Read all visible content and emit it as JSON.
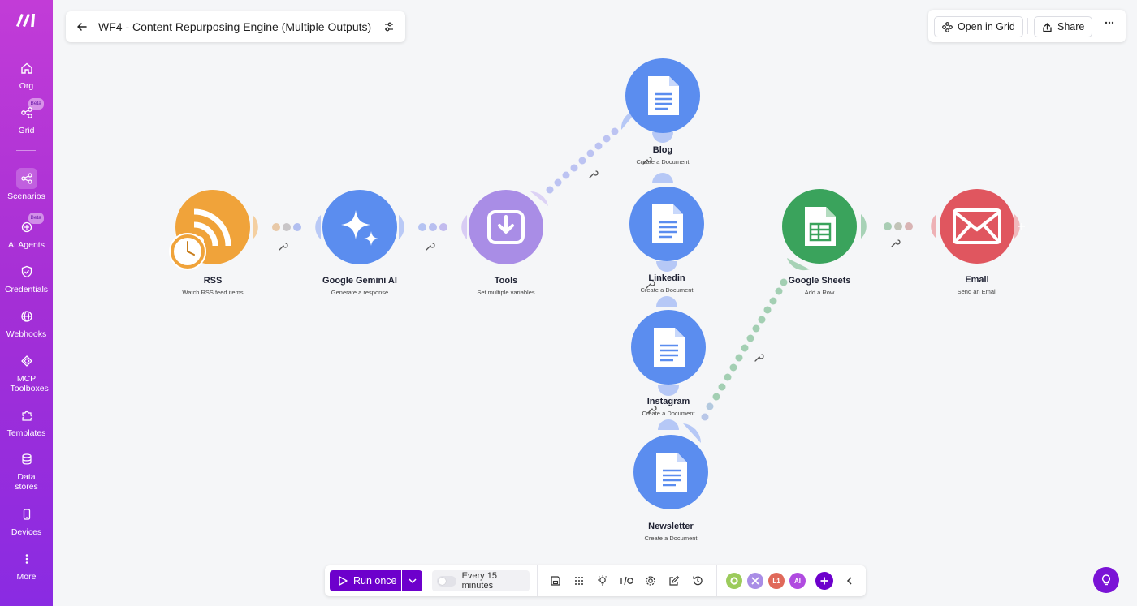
{
  "sidebar": {
    "items": [
      {
        "label": "Org",
        "icon": "home-icon"
      },
      {
        "label": "Grid",
        "icon": "grid-nodes-icon",
        "badge": "Beta"
      },
      {
        "label": "Scenarios",
        "icon": "share-nodes-icon"
      },
      {
        "label": "AI Agents",
        "icon": "ai-agent-icon",
        "badge": "Beta"
      },
      {
        "label": "Credentials",
        "icon": "shield-check-icon"
      },
      {
        "label": "Webhooks",
        "icon": "globe-icon"
      },
      {
        "label": "MCP Toolboxes",
        "icon": "mcp-icon"
      },
      {
        "label": "Templates",
        "icon": "puzzle-icon"
      },
      {
        "label": "Data stores",
        "icon": "database-icon"
      },
      {
        "label": "Devices",
        "icon": "mobile-icon"
      },
      {
        "label": "More",
        "icon": "more-vertical-icon"
      }
    ]
  },
  "header": {
    "title": "WF4 - Content Repurposing Engine (Multiple Outputs)",
    "open_in_grid": "Open in Grid",
    "share": "Share"
  },
  "modules": {
    "rss": {
      "name": "RSS",
      "action": "Watch RSS feed items",
      "color": "#f0a33a"
    },
    "gemini": {
      "name": "Google Gemini AI",
      "action": "Generate a response",
      "color": "#5b8def"
    },
    "tools": {
      "name": "Tools",
      "action": "Set multiple variables",
      "color": "#a98de6"
    },
    "blog": {
      "name": "Blog",
      "action": "Create a Document",
      "color": "#5b8def"
    },
    "linkedin": {
      "name": "Linkedin",
      "action": "Create a Document",
      "color": "#5b8def"
    },
    "instagram": {
      "name": "Instagram",
      "action": "Create a Document",
      "color": "#5b8def"
    },
    "newsletter": {
      "name": "Newsletter",
      "action": "Create a Document",
      "color": "#5b8def"
    },
    "sheets": {
      "name": "Google Sheets",
      "action": "Add a Row",
      "color": "#3aa35c"
    },
    "email": {
      "name": "Email",
      "action": "Send an Email",
      "color": "#e0565f"
    }
  },
  "toolbar": {
    "run_once": "Run once",
    "schedule": "Every 15 minutes",
    "app_badges": [
      "L1",
      "AI"
    ]
  }
}
